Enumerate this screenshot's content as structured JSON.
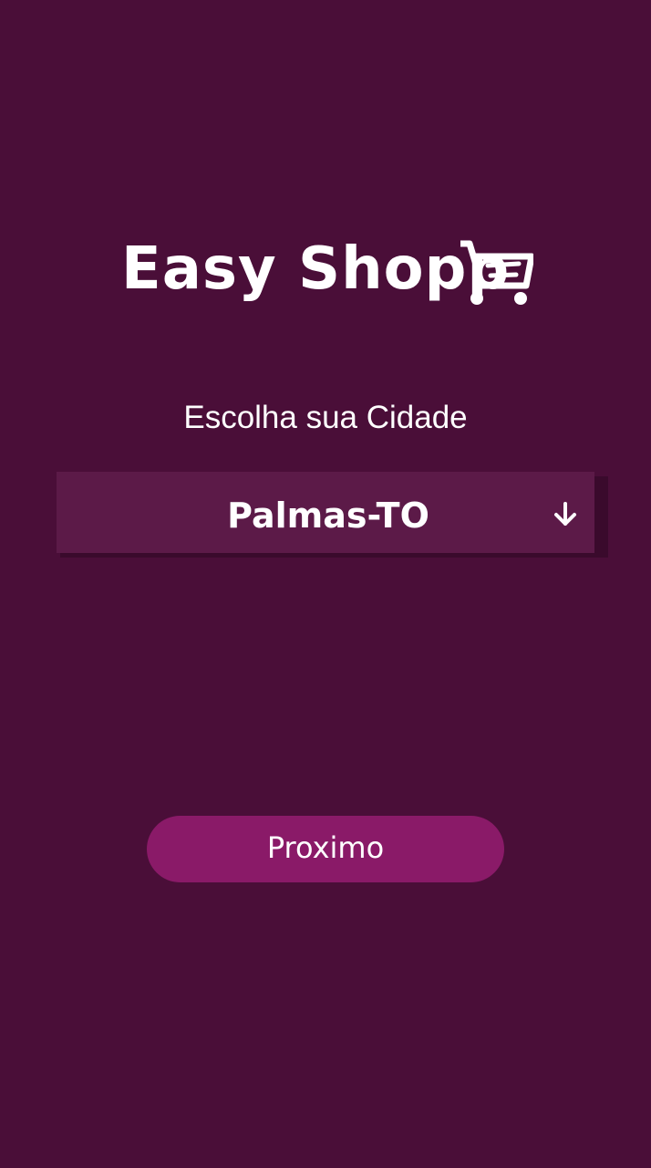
{
  "app": {
    "logo_text": "Easy Shopp",
    "logo_icon": "cart-icon"
  },
  "city_picker": {
    "label": "Escolha sua Cidade",
    "selected": "Palmas-TO",
    "dropdown_icon": "arrow-down-icon"
  },
  "actions": {
    "next_label": "Proximo"
  },
  "colors": {
    "background": "#4a0e38",
    "select_background": "#5c1a48",
    "button_background": "#8a1a68",
    "text": "#ffffff"
  }
}
